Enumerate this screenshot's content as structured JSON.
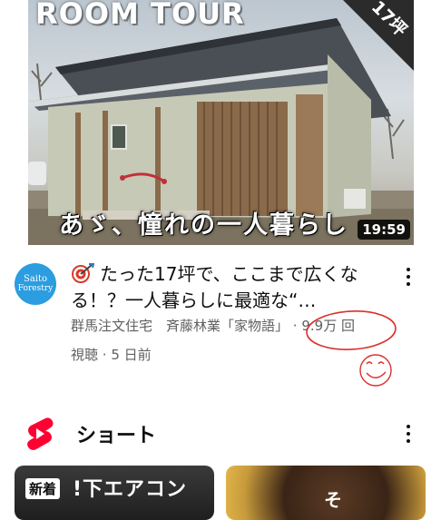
{
  "video": {
    "thumbnail": {
      "title": "ROOM TOUR",
      "corner_label": "17坪",
      "caption": "あゞ、憧れの一人暮らし",
      "duration": "19:59"
    },
    "channel_avatar": {
      "line1": "Saito",
      "line2": "Forestry",
      "color": "#2b9de0"
    },
    "title_icon": "target-icon",
    "title": "たった17坪で、ここまで広くなる！？一人暮らしに最適な“…",
    "channel_name": "群馬注文住宅　斉藤林業「家物語」",
    "separator": "·",
    "views": "9.9万 回",
    "views_suffix": "視聴",
    "age": "5 日前"
  },
  "annotation": {
    "color": "#d9302a",
    "shape": "circle-and-smiley"
  },
  "shorts": {
    "icon": "shorts-icon",
    "label": "ショート",
    "brand_color": "#ff0033",
    "items": [
      {
        "badge": "新着",
        "overlay_text": "!下エアコン"
      },
      {
        "overlay_text": "そ"
      }
    ]
  }
}
